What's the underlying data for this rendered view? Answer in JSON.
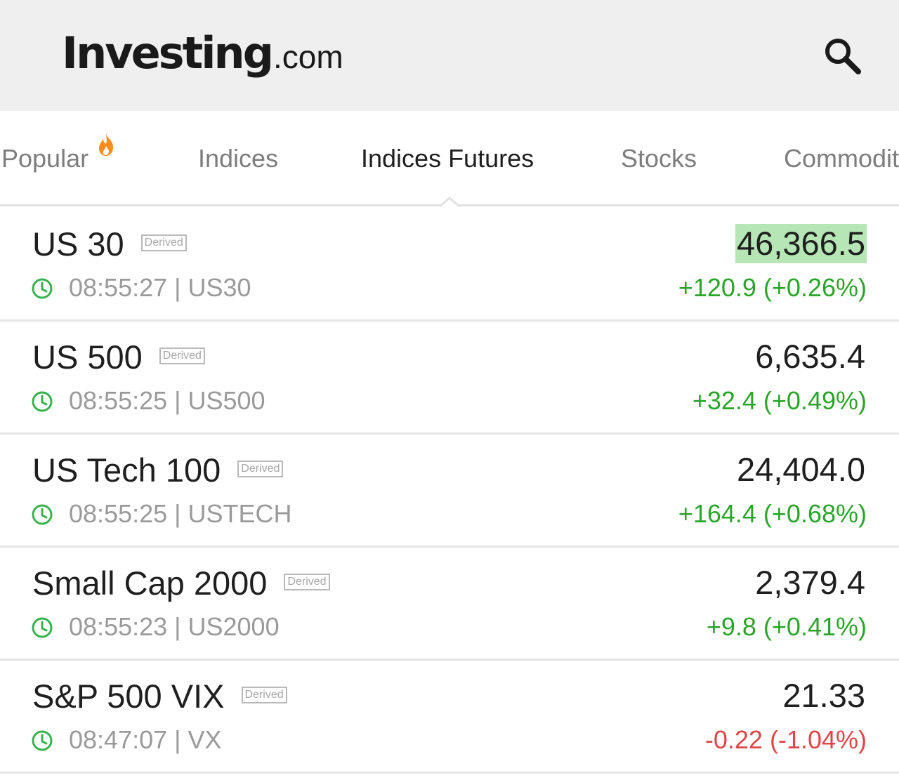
{
  "header": {
    "logo_main": "Investing",
    "logo_domain": ".com",
    "search_icon": "search-icon"
  },
  "tabs": [
    {
      "label": "Popular",
      "active": false,
      "icon": "flame-icon"
    },
    {
      "label": "Indices",
      "active": false
    },
    {
      "label": "Indices Futures",
      "active": true
    },
    {
      "label": "Stocks",
      "active": false
    },
    {
      "label": "Commodit",
      "active": false
    }
  ],
  "rows": [
    {
      "name": "US 30",
      "badge": "Derived",
      "meta": "08:55:27 | US30",
      "price": "46,366.5",
      "change": "+120.9 (+0.26%)",
      "direction": "up",
      "highlighted": true
    },
    {
      "name": "US 500",
      "badge": "Derived",
      "meta": "08:55:25 | US500",
      "price": "6,635.4",
      "change": "+32.4 (+0.49%)",
      "direction": "up",
      "highlighted": false
    },
    {
      "name": "US Tech 100",
      "badge": "Derived",
      "meta": "08:55:25 | USTECH",
      "price": "24,404.0",
      "change": "+164.4 (+0.68%)",
      "direction": "up",
      "highlighted": false
    },
    {
      "name": "Small Cap 2000",
      "badge": "Derived",
      "meta": "08:55:23 | US2000",
      "price": "2,379.4",
      "change": "+9.8 (+0.41%)",
      "direction": "up",
      "highlighted": false
    },
    {
      "name": "S&P 500 VIX",
      "badge": "Derived",
      "meta": "08:47:07 | VX",
      "price": "21.33",
      "change": "-0.22 (-1.04%)",
      "direction": "down",
      "highlighted": false
    }
  ],
  "colors": {
    "up": "#2aa52a",
    "down": "#e04646",
    "clock": "#37b24d",
    "highlight": "#b6e6b6",
    "flame": "#ff8a1e"
  }
}
